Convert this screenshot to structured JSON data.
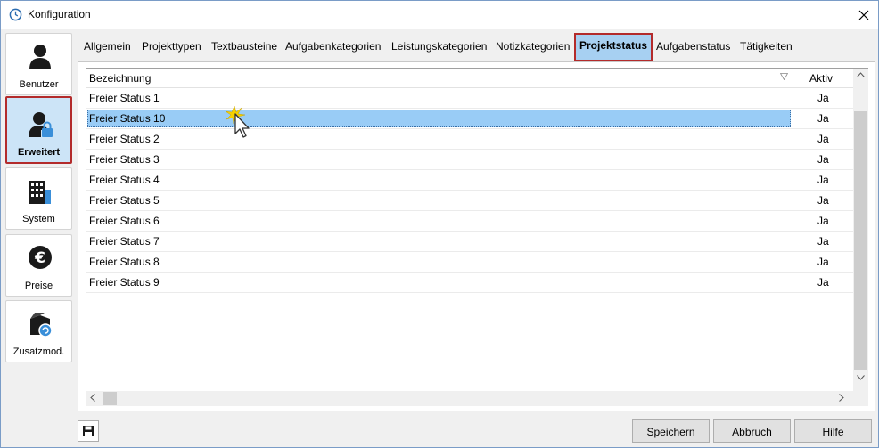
{
  "window": {
    "title": "Konfiguration"
  },
  "sidebar": {
    "items": [
      {
        "label": "Benutzer",
        "icon": "user-icon"
      },
      {
        "label": "Erweitert",
        "icon": "user-lock-icon",
        "active": true
      },
      {
        "label": "System",
        "icon": "building-icon"
      },
      {
        "label": "Preise",
        "icon": "euro-icon"
      },
      {
        "label": "Zusatzmod.",
        "icon": "box-module-icon"
      }
    ]
  },
  "tabs": [
    {
      "label": "Allgemein"
    },
    {
      "label": "Projekttypen"
    },
    {
      "label": "Textbausteine"
    },
    {
      "label": "Aufgabenkategorien"
    },
    {
      "label": "Leistungskategorien"
    },
    {
      "label": "Notizkategorien"
    },
    {
      "label": "Projektstatus",
      "active": true
    },
    {
      "label": "Aufgabenstatus"
    },
    {
      "label": "Tätigkeiten"
    }
  ],
  "grid": {
    "columns": {
      "bezeichnung": "Bezeichnung",
      "aktiv": "Aktiv"
    },
    "rows": [
      {
        "bezeichnung": "Freier Status 1",
        "aktiv": "Ja"
      },
      {
        "bezeichnung": "Freier Status 10",
        "aktiv": "Ja",
        "selected": true
      },
      {
        "bezeichnung": "Freier Status 2",
        "aktiv": "Ja"
      },
      {
        "bezeichnung": "Freier Status 3",
        "aktiv": "Ja"
      },
      {
        "bezeichnung": "Freier Status 4",
        "aktiv": "Ja"
      },
      {
        "bezeichnung": "Freier Status 5",
        "aktiv": "Ja"
      },
      {
        "bezeichnung": "Freier Status 6",
        "aktiv": "Ja"
      },
      {
        "bezeichnung": "Freier Status 7",
        "aktiv": "Ja"
      },
      {
        "bezeichnung": "Freier Status 8",
        "aktiv": "Ja"
      },
      {
        "bezeichnung": "Freier Status 9",
        "aktiv": "Ja"
      }
    ]
  },
  "buttons": {
    "speichern": "Speichern",
    "abbruch": "Abbruch",
    "hilfe": "Hilfe"
  },
  "colors": {
    "accent_highlight": "#b32b2b",
    "selection": "#99ccf6",
    "active_tab": "#a7d0f2"
  }
}
